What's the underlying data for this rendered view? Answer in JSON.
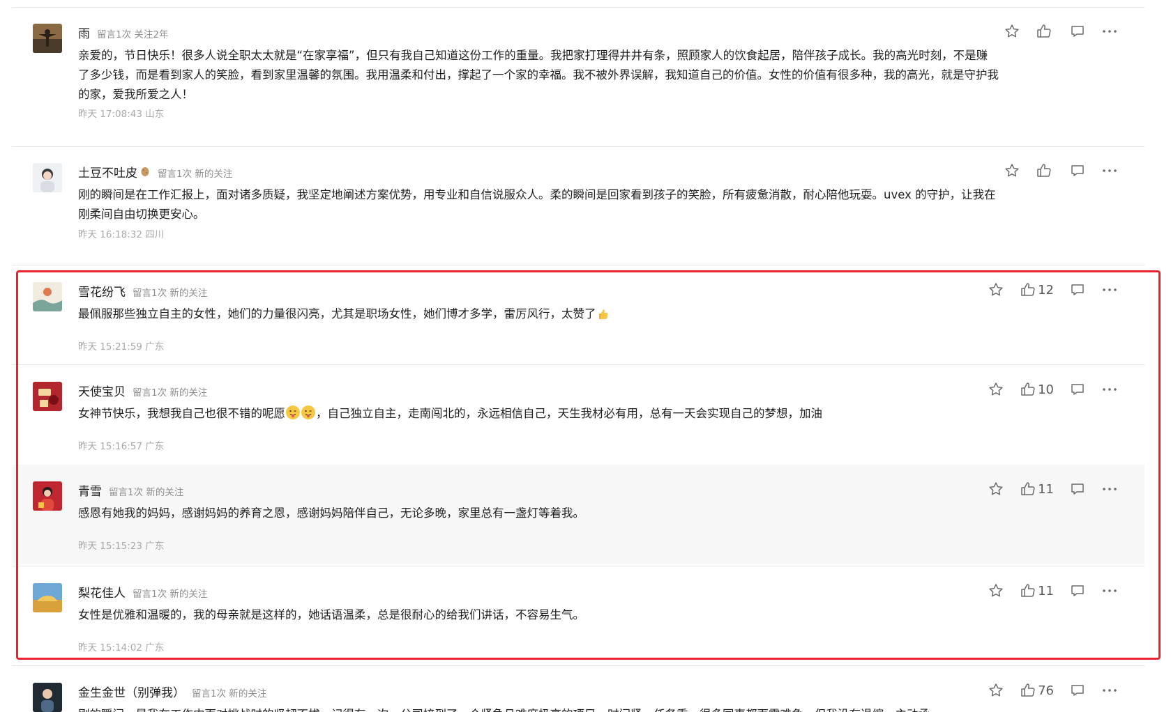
{
  "comments": [
    {
      "nickname": "雨",
      "tag": "留言1次 关注2年",
      "text": "亲爱的，节日快乐！很多人说全职太太就是“在家享福”，但只有我自己知道这份工作的重量。我把家打理得井井有条，照顾家人的饮食起居，陪伴孩子成长。我的高光时刻，不是赚了多少钱，而是看到家人的笑脸，看到家里温馨的氛围。我用温柔和付出，撑起了一个家的幸福。我不被外界误解，我知道自己的价值。女性的价值有很多种，我的高光，就是守护我的家，爱我所爱之人！",
      "time": "昨天 17:08:43 山东",
      "likes": ""
    },
    {
      "nickname": "土豆不吐皮",
      "tag": "留言1次 新的关注",
      "text": "刚的瞬间是在工作汇报上，面对诸多质疑，我坚定地阐述方案优势，用专业和自信说服众人。柔的瞬间是回家看到孩子的笑脸，所有疲惫消散，耐心陪他玩耍。uvex 的守护，让我在刚柔间自由切换更安心。",
      "time": "昨天 16:18:32 四川",
      "likes": ""
    },
    {
      "nickname": "雪花纷飞",
      "tag": "留言1次 新的关注",
      "text": "最佩服那些独立自主的女性，她们的力量很闪亮，尤其是职场女性，她们博才多学，雷厉风行，太赞了",
      "time": "昨天 15:21:59 广东",
      "likes": "12"
    },
    {
      "nickname": "天使宝贝",
      "tag": "留言1次 新的关注",
      "text_a": "女神节快乐，我想我自己也很不错的呢愿",
      "text_b": "，自己独立自主，走南闯北的，永远相信自己，天生我材必有用，总有一天会实现自己的梦想，加油",
      "time": "昨天 15:16:57 广东",
      "likes": "10"
    },
    {
      "nickname": "青雪",
      "tag": "留言1次 新的关注",
      "text": "感恩有她我的妈妈，感谢妈妈的养育之恩，感谢妈妈陪伴自己，无论多晚，家里总有一盏灯等着我。",
      "time": "昨天 15:15:23 广东",
      "likes": "11"
    },
    {
      "nickname": "梨花佳人",
      "tag": "留言1次 新的关注",
      "text": "女性是优雅和温暖的，我的母亲就是这样的，她话语温柔，总是很耐心的给我们讲话，不容易生气。",
      "time": "昨天 15:14:02 广东",
      "likes": "11"
    },
    {
      "nickname": "金生金世（别弹我）",
      "tag": "留言1次 新的关注",
      "text": "刚的瞬间，是我在工作中面对挑战时的坚韧不拔。记得有一次，公司接到了一个紧急且难度极高的项目，时间紧、任务重，很多同事都面露难色，但我没有退缩，主动承",
      "time": "",
      "likes": "76"
    }
  ],
  "colors": {
    "highlight": "#e8232d",
    "shaded_row": "#f7f7f7"
  },
  "icons": [
    "star-icon",
    "thumbs-up-icon",
    "comment-icon",
    "more-icon",
    "thumbs-up-emoji",
    "winking-tongue-emoji"
  ]
}
